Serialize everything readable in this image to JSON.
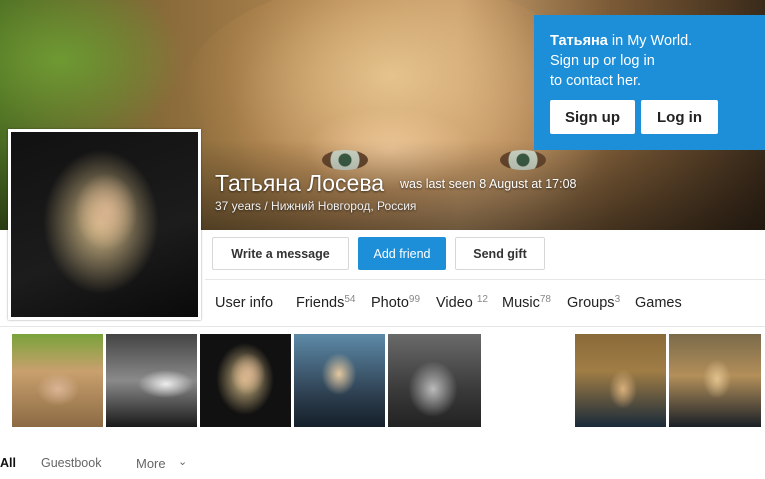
{
  "profile": {
    "name": "Татьяна Лосева",
    "last_seen": "was last seen 8 August at 17:08",
    "meta": "37 years / Нижний Новгород, Россия"
  },
  "promo": {
    "name_bold": "Татьяна",
    "line1_rest": " in My World.",
    "line2": "Sign up or log in",
    "line3": "to contact her.",
    "signup_label": "Sign up",
    "login_label": "Log in"
  },
  "actions": {
    "write_message": "Write a message",
    "add_friend": "Add friend",
    "send_gift": "Send gift"
  },
  "tabs": [
    {
      "label": "User info",
      "count": ""
    },
    {
      "label": "Friends",
      "count": "54"
    },
    {
      "label": "Photo",
      "count": "99"
    },
    {
      "label": "Video",
      "count": "12"
    },
    {
      "label": "Music",
      "count": "78"
    },
    {
      "label": "Groups",
      "count": "3"
    },
    {
      "label": "Games",
      "count": ""
    }
  ],
  "bottom_tabs": {
    "all": "All",
    "guestbook": "Guestbook",
    "more": "More"
  },
  "colors": {
    "accent": "#1d8fd9"
  }
}
